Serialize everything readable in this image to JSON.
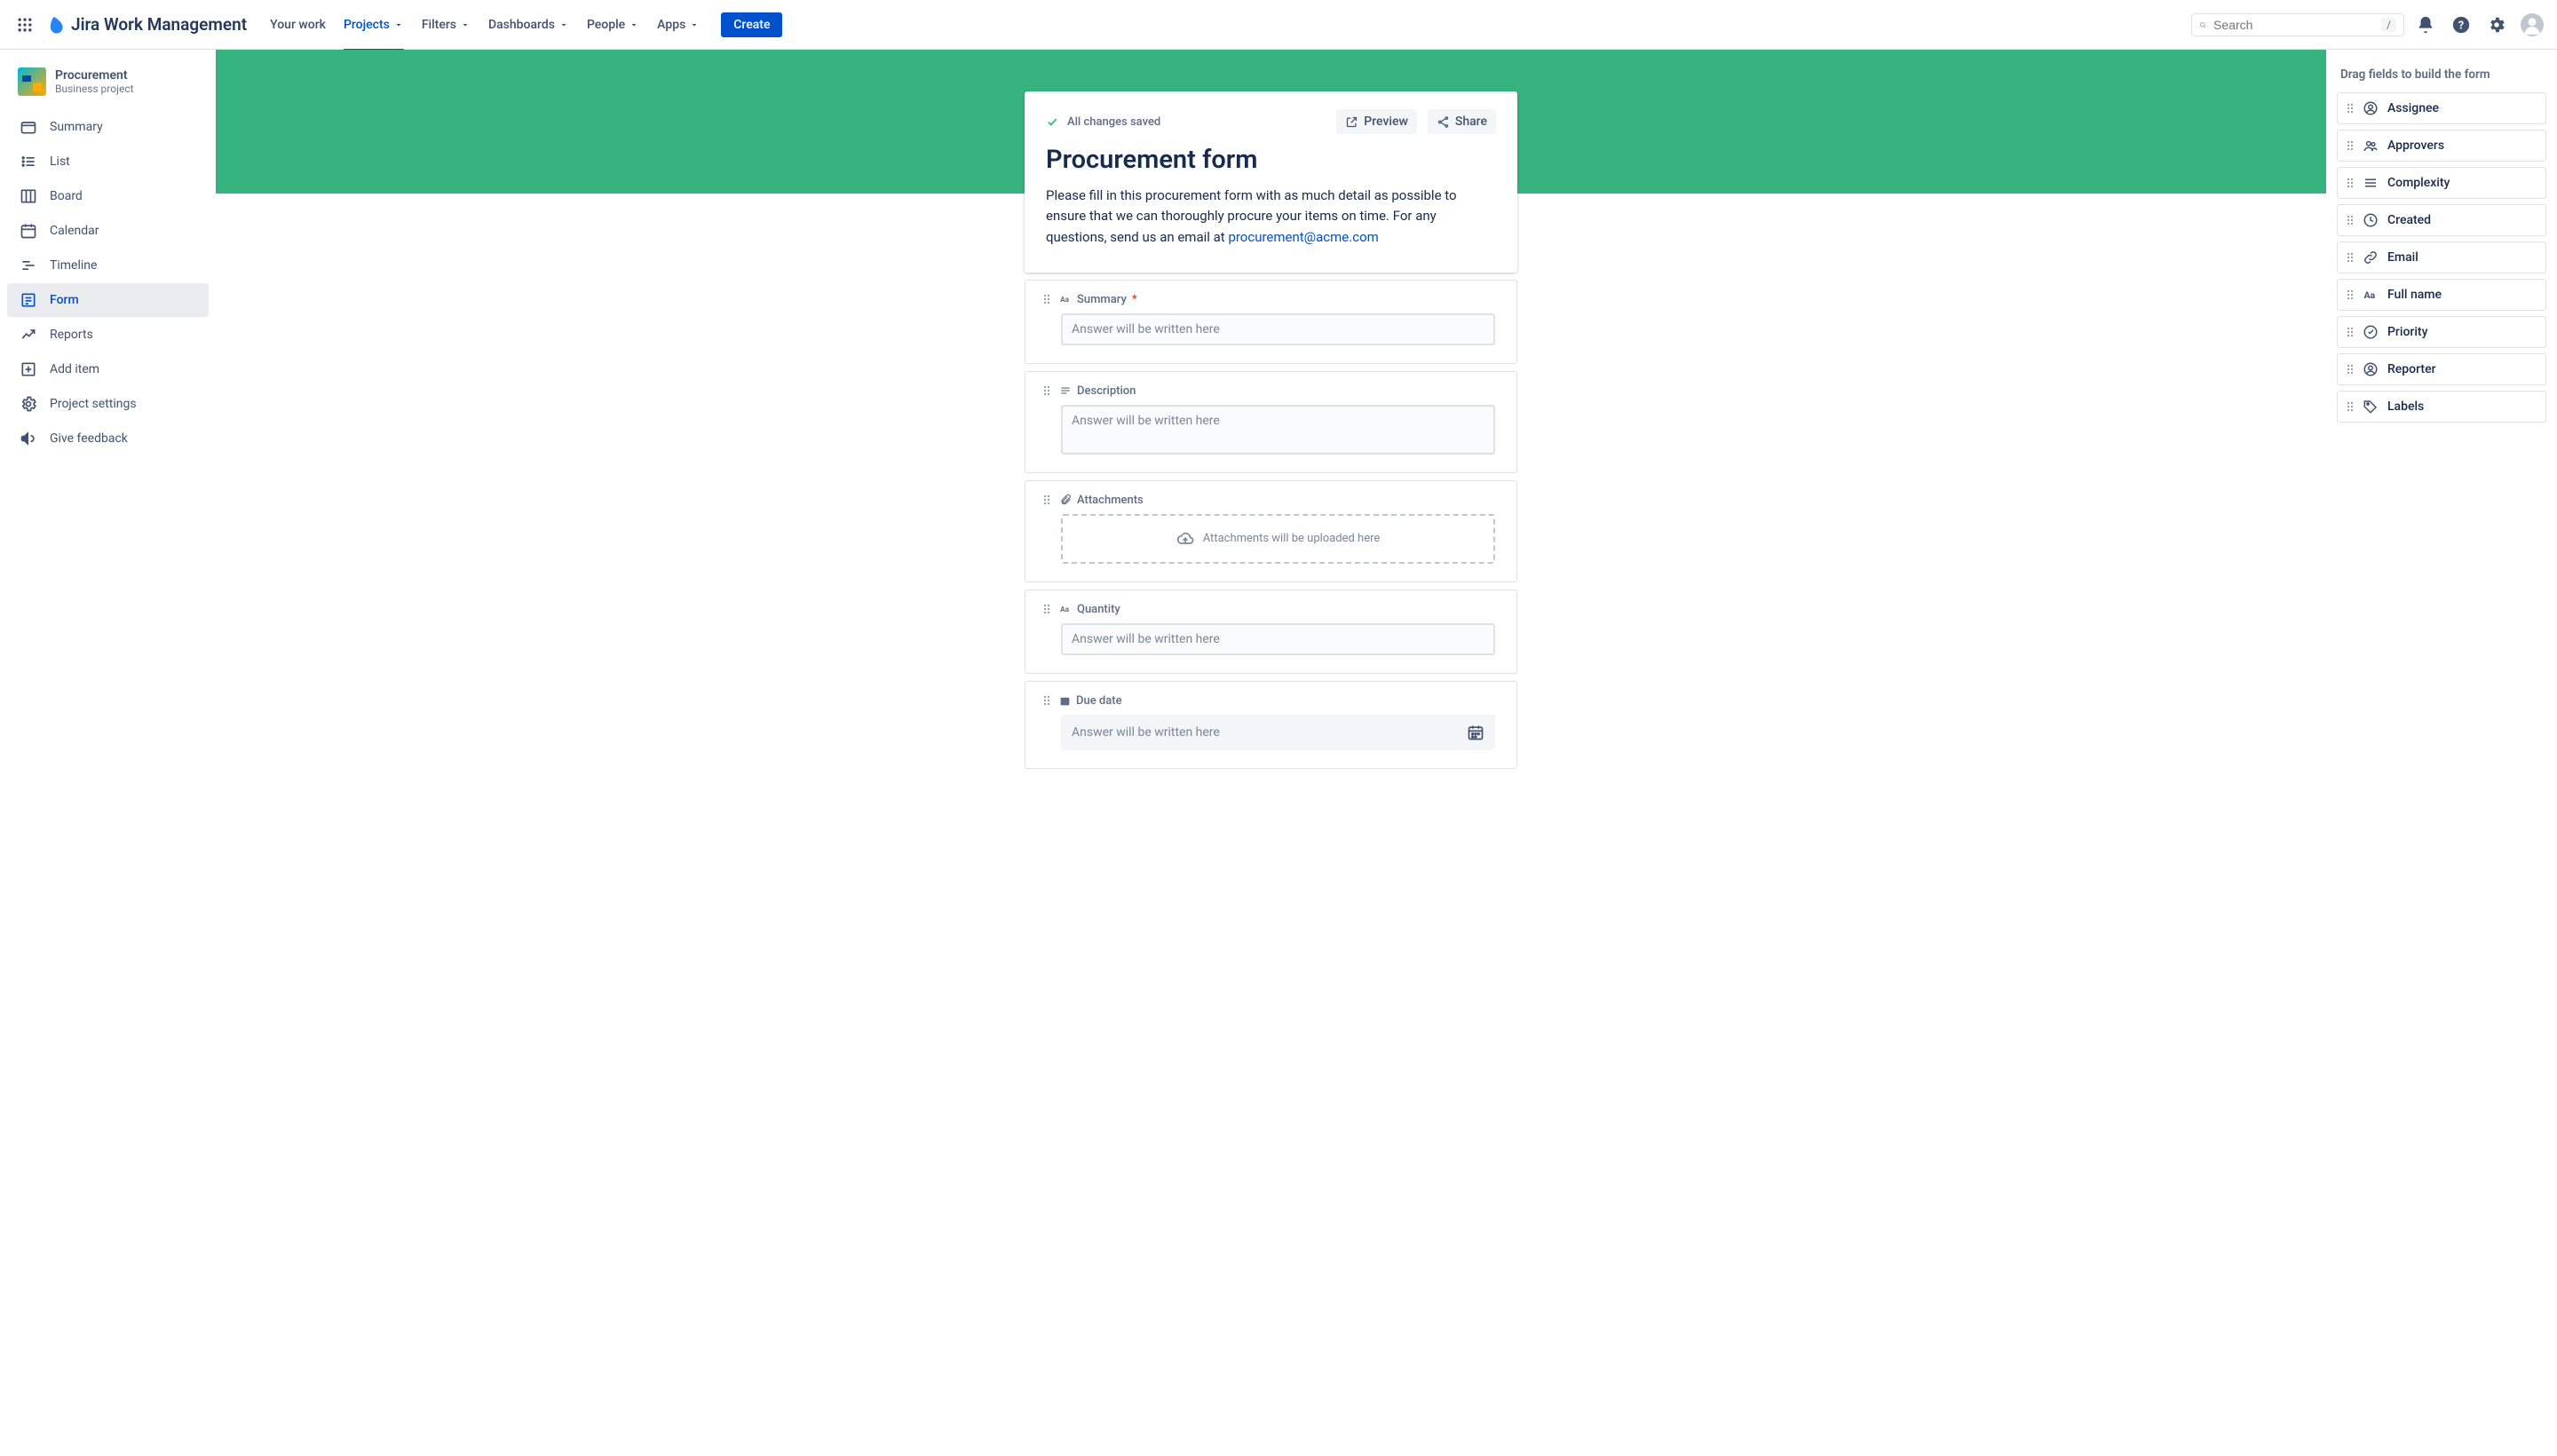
{
  "app_name": "Jira Work Management",
  "nav": {
    "your_work": "Your work",
    "projects": "Projects",
    "filters": "Filters",
    "dashboards": "Dashboards",
    "people": "People",
    "apps": "Apps",
    "create": "Create"
  },
  "search": {
    "placeholder": "Search",
    "shortcut": "/"
  },
  "project": {
    "name": "Procurement",
    "type": "Business project"
  },
  "sidebar": {
    "summary": "Summary",
    "list": "List",
    "board": "Board",
    "calendar": "Calendar",
    "timeline": "Timeline",
    "form": "Form",
    "reports": "Reports",
    "add_item": "Add item",
    "project_settings": "Project settings",
    "give_feedback": "Give feedback"
  },
  "form_builder": {
    "saved_status": "All changes saved",
    "preview": "Preview",
    "share": "Share",
    "title": "Procurement form",
    "description_pre": "Please fill in this procurement form with as much detail as possible to ensure that we can thoroughly procure your items on time. For any questions, send us an email at ",
    "email": "procurement@acme.com",
    "placeholder": "Answer will be written here",
    "dropzone": "Attachments will be uploaded here",
    "fields": {
      "summary": "Summary",
      "description": "Description",
      "attachments": "Attachments",
      "quantity": "Quantity",
      "due_date": "Due date"
    }
  },
  "right_panel": {
    "title": "Drag fields to build the form",
    "items": {
      "assignee": "Assignee",
      "approvers": "Approvers",
      "complexity": "Complexity",
      "created": "Created",
      "email": "Email",
      "full_name": "Full name",
      "priority": "Priority",
      "reporter": "Reporter",
      "labels": "Labels"
    }
  }
}
